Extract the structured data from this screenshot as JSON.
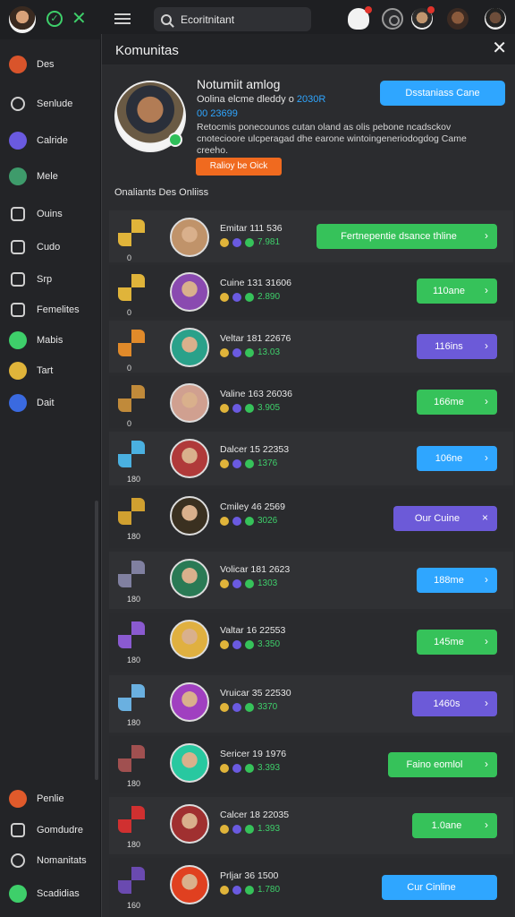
{
  "topbar": {
    "search_value": "Ecoritnitant"
  },
  "sidebar": {
    "items": [
      {
        "label": "Des",
        "color": "#d9542b"
      },
      {
        "label": "Senlude",
        "color": "#cfcfcf"
      },
      {
        "label": "Calride",
        "color": "#6a5ae0"
      },
      {
        "label": "Mele",
        "color": "#3e9b6b"
      },
      {
        "label": "Ouins",
        "color": "#cfcfcf"
      },
      {
        "label": "Cudo",
        "color": "#cfcfcf"
      },
      {
        "label": "Srp",
        "color": "#cfcfcf"
      },
      {
        "label": "Femelites",
        "color": "#cfcfcf"
      },
      {
        "label": "Mabis",
        "color": "#3ecf6a"
      },
      {
        "label": "Tart",
        "color": "#e0b43a"
      },
      {
        "label": "Dait",
        "color": "#3a6ae0"
      }
    ],
    "bottom": [
      {
        "label": "Penlie",
        "color": "#e05a2b"
      },
      {
        "label": "Gomdudre",
        "color": "#cfcfcf"
      },
      {
        "label": "Nomanitats",
        "color": "#cfcfcf"
      },
      {
        "label": "Scadidias",
        "color": "#3ecf6a"
      }
    ]
  },
  "modal": {
    "title": "Komunitas",
    "profile": {
      "name": "Notumiit amlog",
      "line1_text": "Oolina elcme dleddy o",
      "line1_accent": "2030R",
      "line2": "00 23699",
      "desc": "Retocmis ponecounos cutan oland as olis pebone ncadsckov cnotecioore ulcperagad dhe earone wintoingeneriodogdog Came creeho.",
      "button": "Ralioy be Oick"
    },
    "cta": "Dsstaniass Cane",
    "section_title": "Onaliants Des Onliiss",
    "rows": [
      {
        "name": "Emitar 111 536",
        "meta": "7.981",
        "button": "Fertnepentie dsance thline",
        "btn_color": "green",
        "chev": "›",
        "level": "0"
      },
      {
        "name": "Cuine 131 31606",
        "meta": "2.890",
        "button": "110ane",
        "btn_color": "green",
        "chev": "›",
        "level": "0"
      },
      {
        "name": "Veltar 181 22676",
        "meta": "13.03",
        "button": "116ins",
        "btn_color": "purple",
        "chev": "›",
        "level": "0"
      },
      {
        "name": "Valine 163 26036",
        "meta": "3.905",
        "button": "166me",
        "btn_color": "green",
        "chev": "›",
        "level": "0"
      },
      {
        "name": "Dalcer 15 22353",
        "meta": "1376",
        "button": "106ne",
        "btn_color": "blue",
        "chev": "›",
        "level": "180"
      },
      {
        "name": "Cmiley 46 2569",
        "meta": "3026",
        "button": "Our Cuine",
        "btn_color": "purple",
        "chev": "×",
        "level": "180"
      },
      {
        "name": "Volicar 181 2623",
        "meta": "1303",
        "button": "188me",
        "btn_color": "blue",
        "chev": "›",
        "level": "180"
      },
      {
        "name": "Valtar 16 22553",
        "meta": "3.350",
        "button": "145me",
        "btn_color": "green",
        "chev": "›",
        "level": "180"
      },
      {
        "name": "Vruicar 35 22530",
        "meta": "3370",
        "button": "1460s",
        "btn_color": "purple",
        "chev": "›",
        "level": "180"
      },
      {
        "name": "Sericer 19 1976",
        "meta": "3.393",
        "button": "Faino eomlol",
        "btn_color": "green",
        "chev": "›",
        "level": "180"
      },
      {
        "name": "Calcer 18 22035",
        "meta": "1.393",
        "button": "1.0ane",
        "btn_color": "green",
        "chev": "›",
        "level": "180"
      },
      {
        "name": "Prljar 36 1500",
        "meta": "1.780",
        "button": "Cur Cinline",
        "btn_color": "blue",
        "chev": "",
        "level": "160"
      }
    ]
  },
  "colors": {
    "green": "#36c25a",
    "blue": "#2fa6ff",
    "purple": "#6c5ad8",
    "orange": "#f06a1f"
  }
}
